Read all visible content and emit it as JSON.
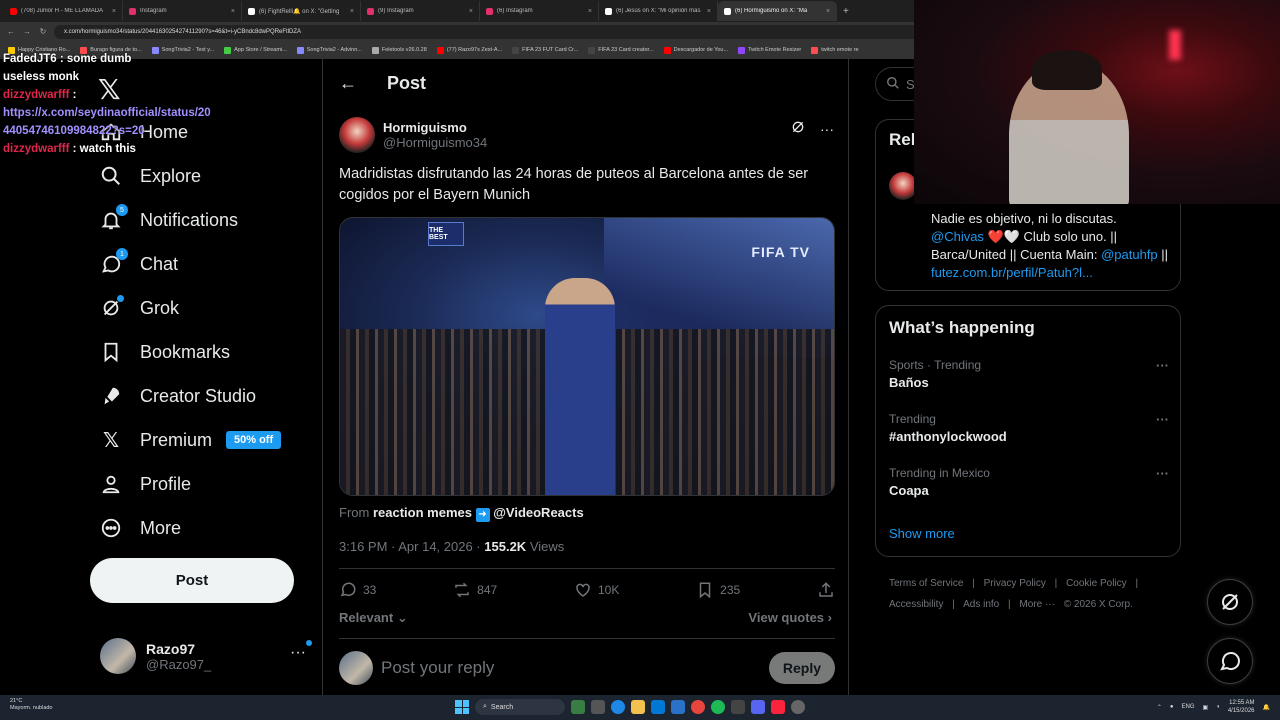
{
  "browser": {
    "tabs": [
      {
        "label": "(708) Junior H - ME LLAMADA",
        "color": "#ff0000"
      },
      {
        "label": "Instagram",
        "color": "#e1306c"
      },
      {
        "label": "(6) FightRelli🔔 on X: \"Getting",
        "color": "#ffffff"
      },
      {
        "label": "(9) Instagram",
        "color": "#e1306c"
      },
      {
        "label": "(6) Instagram",
        "color": "#e1306c"
      },
      {
        "label": "(6) Jesús on X: \"Mi opinión más",
        "color": "#ffffff"
      },
      {
        "label": "(6) Hormiguismo on X: \"Ma",
        "color": "#ffffff",
        "active": true
      }
    ],
    "url": "x.com/hormiguismo34/status/2044163025427411290?s=46&t=i-yCBndc8dwPQReFtlDZA",
    "bookmarks": [
      {
        "label": "Happy Cristiano Ro...",
        "color": "#ffcc00"
      },
      {
        "label": "Burago figura de to...",
        "color": "#ff4d4d"
      },
      {
        "label": "SongTrivia2 - Test y...",
        "color": "#8888ff"
      },
      {
        "label": "App Store / Streami...",
        "color": "#44cc44"
      },
      {
        "label": "SongTrivia2 - Advinn...",
        "color": "#8888ff"
      },
      {
        "label": "Feletools v26.0.28",
        "color": "#aaaaaa"
      },
      {
        "label": "(77) Razo97s Zest-A...",
        "color": "#ff0000"
      },
      {
        "label": "FIFA 23 FUT Card Cr...",
        "color": "#444444"
      },
      {
        "label": "FIFA 23 Card creator...",
        "color": "#444444"
      },
      {
        "label": "Descargador de You...",
        "color": "#ff0000"
      },
      {
        "label": "Twitch Emote Resizer",
        "color": "#9146ff"
      },
      {
        "label": "twitch emote re",
        "color": "#ff4d4d"
      }
    ]
  },
  "chat": [
    {
      "user": "FadedJT6",
      "msg": ": some dumb"
    },
    {
      "user": "",
      "msg": "useless monk"
    },
    {
      "user": "dizzydwarfff",
      "msg": ":"
    },
    {
      "link": "https://x.com/seydinaofficial/status/2044054746109984822?s=20"
    },
    {
      "user": "dizzydwarfff",
      "msg": ": watch this"
    }
  ],
  "nav": {
    "items": [
      {
        "label": "Home"
      },
      {
        "label": "Explore"
      },
      {
        "label": "Notifications",
        "badge": "5"
      },
      {
        "label": "Chat",
        "badge": "1"
      },
      {
        "label": "Grok"
      },
      {
        "label": "Bookmarks"
      },
      {
        "label": "Creator Studio"
      },
      {
        "label": "Premium",
        "tag": "50% off"
      },
      {
        "label": "Profile"
      },
      {
        "label": "More"
      }
    ],
    "post_button": "Post",
    "account": {
      "name": "Razo97",
      "handle": "@Razo97_"
    }
  },
  "post": {
    "header": "Post",
    "author_name": "Hormiguismo",
    "author_handle": "@Hormiguismo34",
    "text": "Madridistas disfrutando las 24 horas de puteos al Barcelona antes de ser cogidos por el Bayern Munich",
    "media": {
      "sign": "THE BEST",
      "watermark": "FIFA TV"
    },
    "from_prefix": "From",
    "from_name": "reaction memes",
    "from_handle": "@VideoReacts",
    "time": "3:16 PM · Apr 14, 2026 ·",
    "views_count": "155.2K",
    "views_label": "Views",
    "stats": {
      "replies": "33",
      "reposts": "847",
      "likes": "10K",
      "bookmarks": "235"
    },
    "relevant": "Relevant",
    "view_quotes": "View quotes",
    "reply_placeholder": "Post your reply",
    "reply_button": "Reply"
  },
  "right": {
    "search_placeholder": "Se",
    "relevant_title": "Rel",
    "bio": {
      "line1": "Nadie es objetivo, ni lo discutas.",
      "mention1": "@Chivas",
      "mid": "❤️🤍 Club solo uno. || Barca/United || Cuenta Main:",
      "mention2": "@patuhfp",
      "sep": "||",
      "link": "futez.com.br/perfil/Patuh?l..."
    },
    "trending_title": "What’s happening",
    "trends": [
      {
        "context": "Sports · Trending",
        "name": "Baños"
      },
      {
        "context": "Trending",
        "name": "#anthonylockwood"
      },
      {
        "context": "Trending in Mexico",
        "name": "Coapa"
      }
    ],
    "show_more": "Show more",
    "footer": [
      "Terms of Service",
      "|",
      "Privacy Policy",
      "|",
      "Cookie Policy",
      "|",
      "Accessibility",
      "|",
      "Ads info",
      "|",
      "More ···",
      "© 2026 X Corp."
    ]
  },
  "taskbar": {
    "weather_temp": "21°C",
    "weather_desc": "Mayorm. nublado",
    "search": "Search",
    "lang": "ENG",
    "time": "12:55 AM",
    "date": "4/15/2026"
  }
}
